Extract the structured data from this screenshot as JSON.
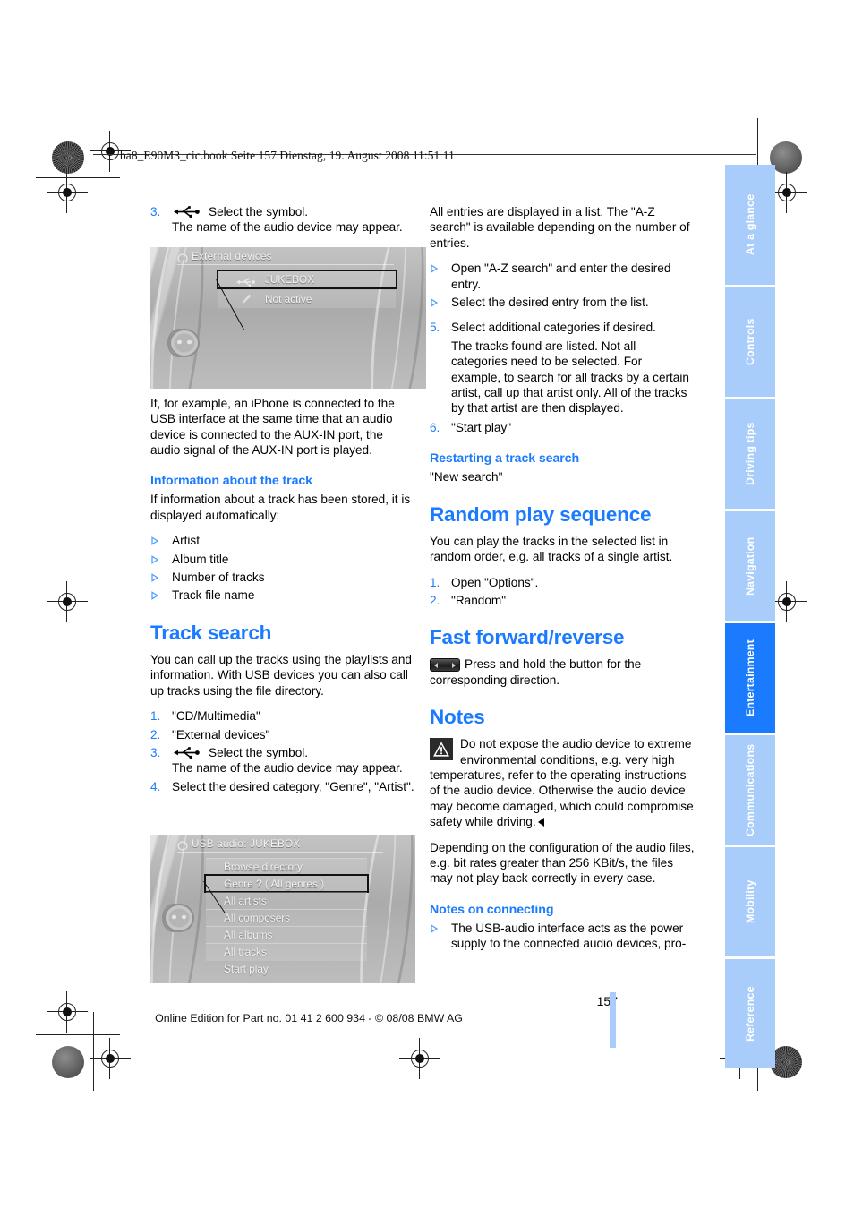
{
  "header": {
    "filename_line": "ba8_E90M3_cic.book  Seite 157  Dienstag, 19. August 2008  11:51 11"
  },
  "colors": {
    "accent_blue": "#1a7bff",
    "tab_inactive": "#a8cdfa",
    "tab_active": "#1a7bff",
    "body_text": "#000000"
  },
  "left_column": {
    "step3": {
      "num": "3.",
      "icon": "usb-icon",
      "text": "Select the symbol.",
      "subtext": "The name of the audio device may appear."
    },
    "screenshot_external_devices": {
      "title": "External devices",
      "title_icon": "cd-multimedia-icon",
      "rows": [
        {
          "label": "JUKEBOX",
          "icon": "usb-icon",
          "selected": true
        },
        {
          "label": "Not active",
          "icon": "aux-plug-icon",
          "selected": false
        }
      ],
      "controller_icon": "idrive-controller-icon"
    },
    "paragraph_iphone": "If, for example, an iPhone is connected to the USB interface at the same time that an audio device is connected to the AUX-IN port, the audio signal of the AUX-IN port is played.",
    "heading_info_track": "Information about the track",
    "paragraph_info_track": "If information about a track has been stored, it is displayed automatically:",
    "info_track_bullets": [
      "Artist",
      "Album title",
      "Number of tracks",
      "Track file name"
    ],
    "heading_track_search": "Track search",
    "paragraph_track_search": "You can call up the tracks using the playlists and information. With USB devices you can also call up tracks using the file directory.",
    "track_search_steps": [
      {
        "num": "1.",
        "text": "\"CD/Multimedia\"",
        "subtext": "",
        "icon": ""
      },
      {
        "num": "2.",
        "text": "\"External devices\"",
        "subtext": "",
        "icon": ""
      },
      {
        "num": "3.",
        "text": "Select the symbol.",
        "subtext": "The name of the audio device may appear.",
        "icon": "usb-icon"
      },
      {
        "num": "4.",
        "text": "Select the desired category, \"Genre\", \"Artist\".",
        "subtext": "",
        "icon": ""
      }
    ],
    "screenshot_usb_audio": {
      "title": "USB audio: JUKEBOX",
      "title_icon": "cd-multimedia-icon",
      "rows": [
        {
          "label": "Browse directory",
          "selected": false
        },
        {
          "label": "Genre ? ( All genres )",
          "selected": true
        },
        {
          "label": "All artists",
          "selected": false
        },
        {
          "label": "All composers",
          "selected": false
        },
        {
          "label": "All albums",
          "selected": false
        },
        {
          "label": "All tracks",
          "selected": false
        },
        {
          "label": "Start play",
          "selected": false
        }
      ],
      "controller_icon": "idrive-controller-icon"
    }
  },
  "right_column": {
    "paragraph_all_entries": "All entries are displayed in a list. The \"A-Z search\" is available depending on the number of entries.",
    "az_bullets": [
      "Open \"A-Z search\" and enter the desired entry.",
      "Select the desired entry from the list."
    ],
    "steps_5_6": [
      {
        "num": "5.",
        "text": "Select additional categories if desired.",
        "subtext": "The tracks found are listed. Not all categories need to be selected. For example, to search for all tracks by a certain artist, call up that artist only. All of the tracks by that artist are then displayed."
      },
      {
        "num": "6.",
        "text": "\"Start play\"",
        "subtext": ""
      }
    ],
    "heading_restarting": "Restarting a track search",
    "paragraph_restarting": "\"New search\"",
    "heading_random": "Random play sequence",
    "paragraph_random": "You can play the tracks in the selected list in random order, e.g. all tracks of a single artist.",
    "random_steps": [
      {
        "num": "1.",
        "text": "Open \"Options\"."
      },
      {
        "num": "2.",
        "text": "\"Random\""
      }
    ],
    "heading_fast_forward": "Fast forward/reverse",
    "fast_forward_icon": "fast-forward-reverse-button-icon",
    "paragraph_fast_forward": "Press and hold the button for the corresponding direction.",
    "heading_notes": "Notes",
    "warning_icon": "warning-triangle-icon",
    "paragraph_warning": "Do not expose the audio device to extreme environmental conditions, e.g. very high temperatures, refer to the operating instructions of the audio device. Otherwise the audio device may become damaged, which could compromise safety while driving.",
    "paragraph_bitrate": "Depending on the configuration of the audio files, e.g. bit rates greater than 256 KBit/s, the files may not play back correctly in every case.",
    "heading_notes_connecting": "Notes on connecting",
    "connecting_bullets": [
      "The USB-audio interface acts as the power supply to the connected audio devices, pro-"
    ]
  },
  "rail_tabs": [
    {
      "label": "At a glance",
      "active": false
    },
    {
      "label": "Controls",
      "active": false
    },
    {
      "label": "Driving tips",
      "active": false
    },
    {
      "label": "Navigation",
      "active": false
    },
    {
      "label": "Entertainment",
      "active": true
    },
    {
      "label": "Communications",
      "active": false
    },
    {
      "label": "Mobility",
      "active": false
    },
    {
      "label": "Reference",
      "active": false
    }
  ],
  "footer": {
    "page_number": "157",
    "text": "Online Edition for Part no. 01 41 2 600 934 - © 08/08 BMW AG"
  }
}
